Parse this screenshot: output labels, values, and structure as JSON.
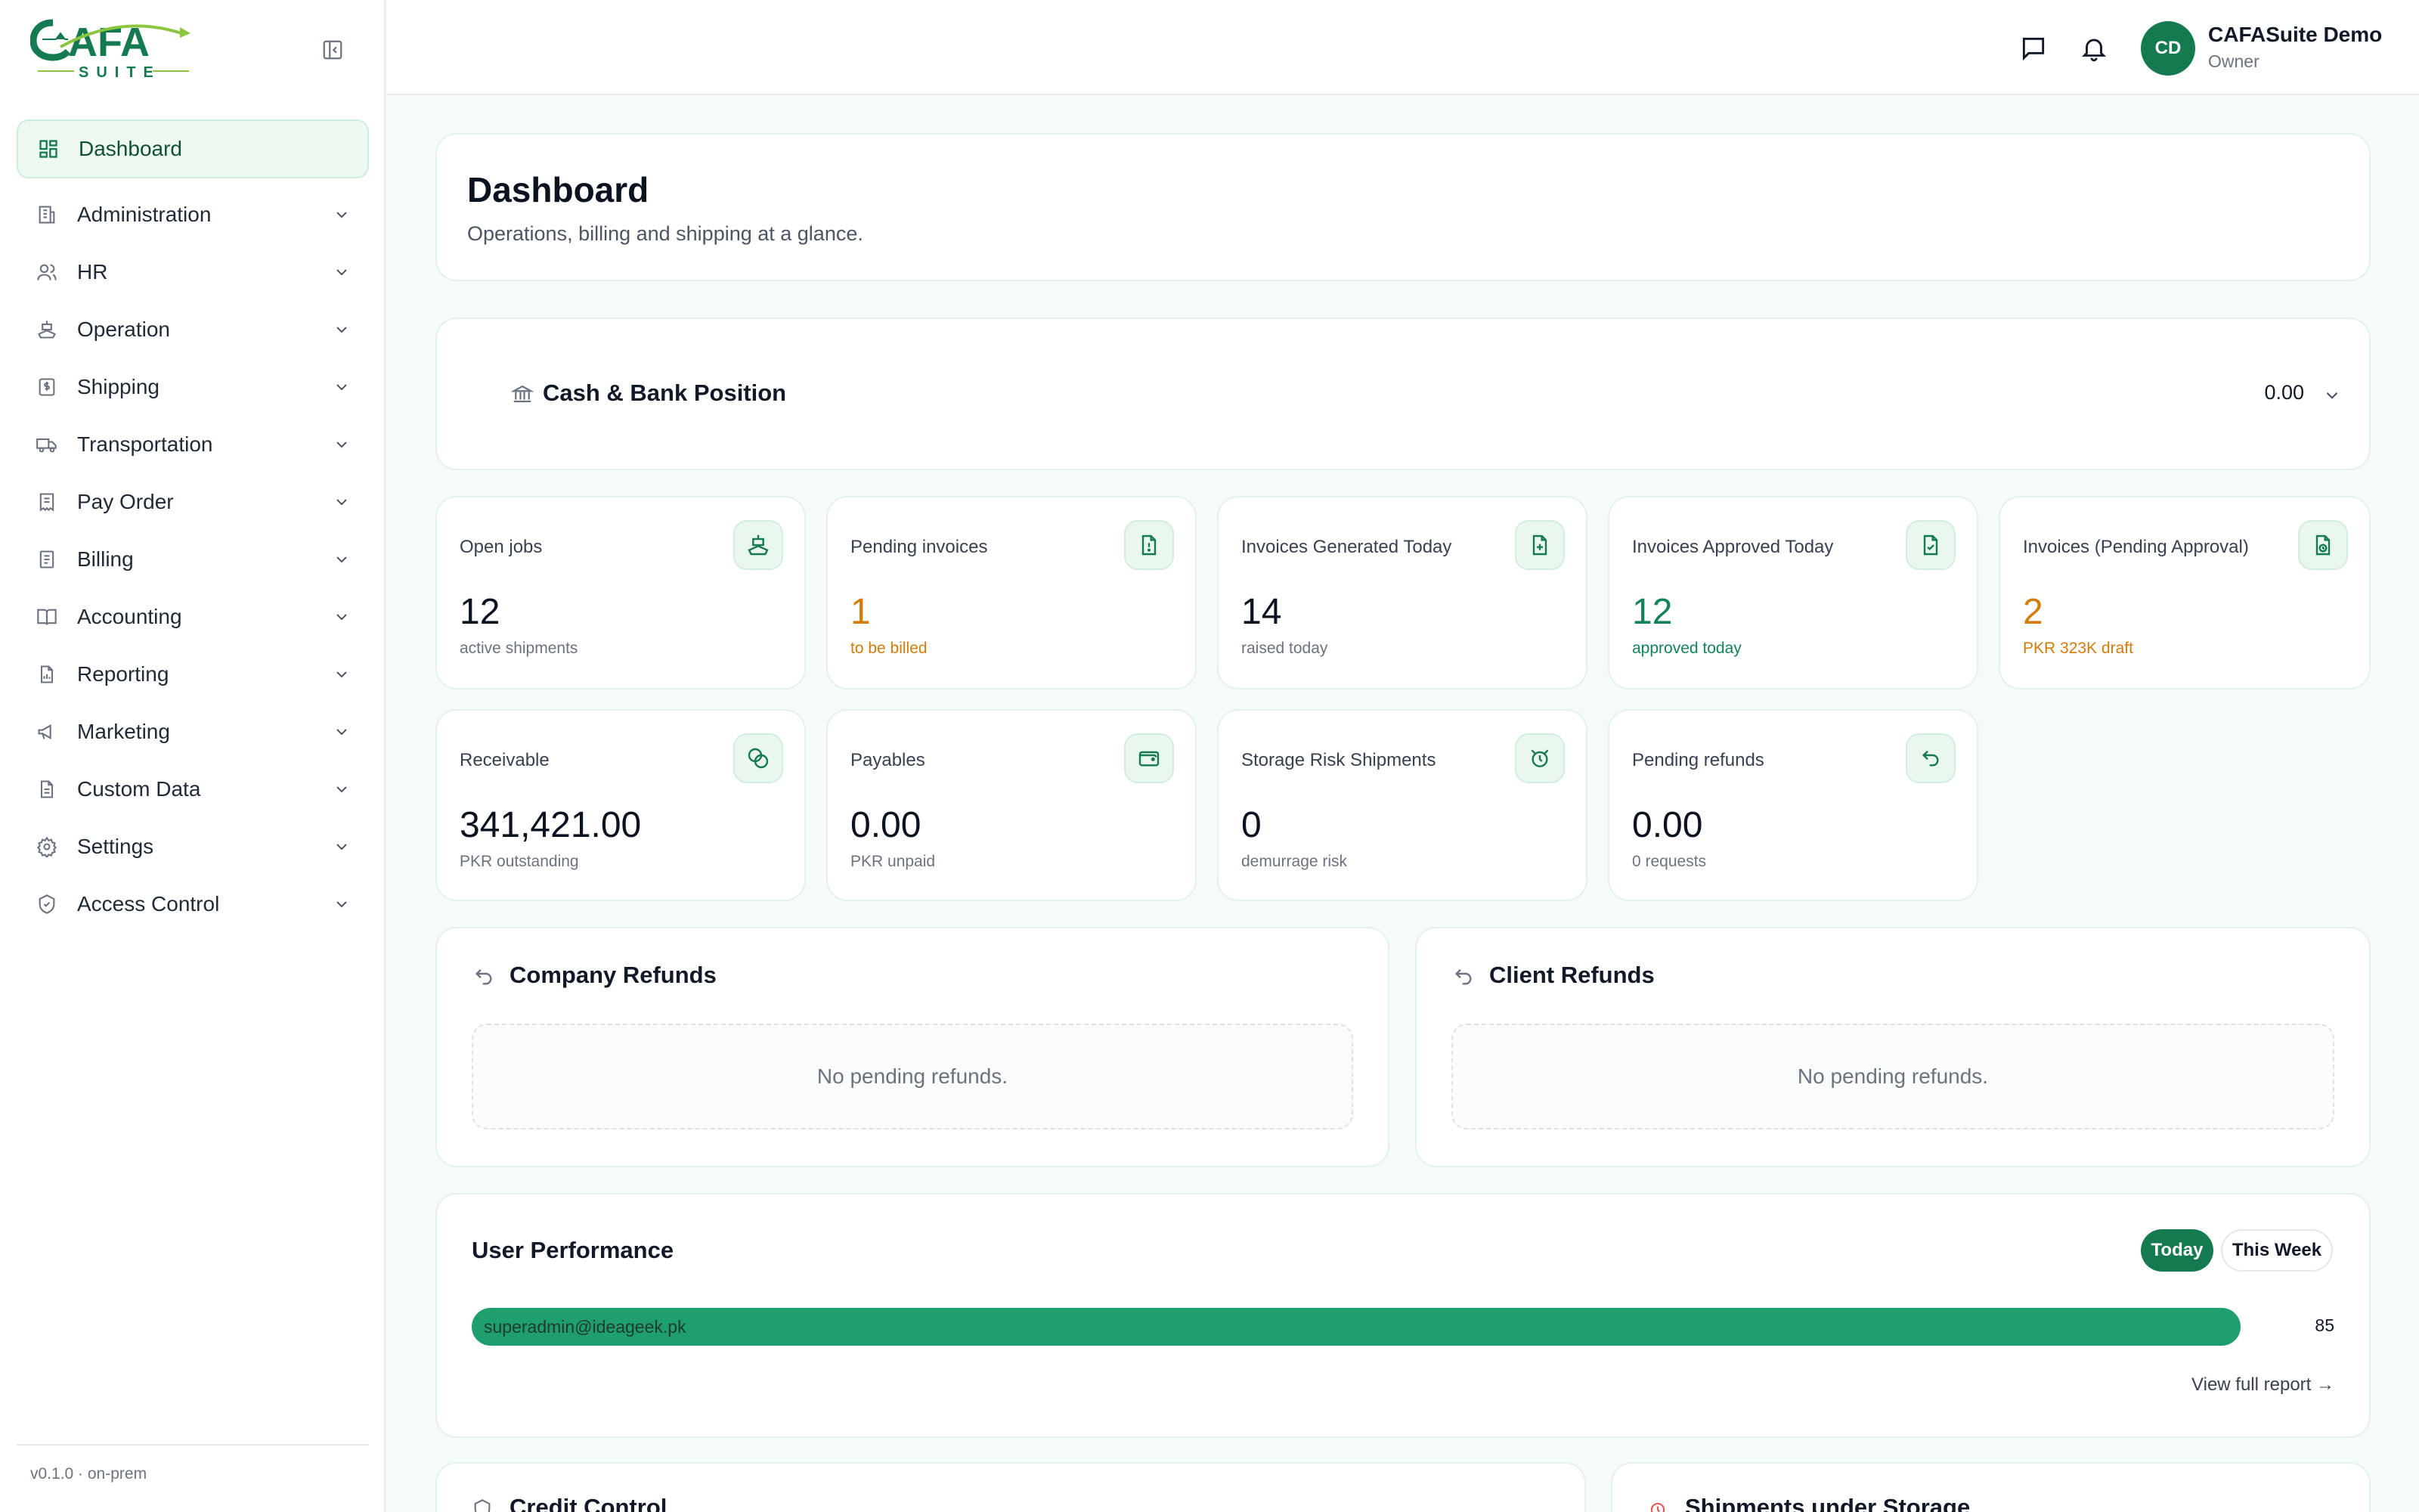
{
  "brand": {
    "logo_top": "CAFA",
    "logo_bottom": "SUITE",
    "version": "v0.1.0 · on-prem"
  },
  "sidebar": {
    "items": [
      {
        "label": "Dashboard",
        "icon": "grid-icon",
        "active": true
      },
      {
        "label": "Administration",
        "icon": "building-icon"
      },
      {
        "label": "HR",
        "icon": "users-icon"
      },
      {
        "label": "Operation",
        "icon": "ship-icon"
      },
      {
        "label": "Shipping",
        "icon": "dollar-doc-icon"
      },
      {
        "label": "Transportation",
        "icon": "truck-icon"
      },
      {
        "label": "Pay Order",
        "icon": "receipt-icon"
      },
      {
        "label": "Billing",
        "icon": "billing-icon"
      },
      {
        "label": "Accounting",
        "icon": "book-icon"
      },
      {
        "label": "Reporting",
        "icon": "report-icon"
      },
      {
        "label": "Marketing",
        "icon": "megaphone-icon"
      },
      {
        "label": "Custom Data",
        "icon": "file-icon"
      },
      {
        "label": "Settings",
        "icon": "gear-icon"
      },
      {
        "label": "Access Control",
        "icon": "shield-icon"
      }
    ]
  },
  "header": {
    "user_initials": "CD",
    "user_name": "CAFASuite Demo",
    "user_role": "Owner"
  },
  "page": {
    "title": "Dashboard",
    "subtitle": "Operations, billing and shipping at a glance."
  },
  "cash": {
    "title": "Cash & Bank Position",
    "value": "0.00"
  },
  "stats": [
    {
      "label": "Open jobs",
      "value": "12",
      "sub": "active shipments",
      "tone": "default",
      "icon": "ship-icon"
    },
    {
      "label": "Pending invoices",
      "value": "1",
      "sub": "to be billed",
      "tone": "orange",
      "icon": "file-alert-icon"
    },
    {
      "label": "Invoices Generated Today",
      "value": "14",
      "sub": "raised today",
      "tone": "default",
      "icon": "file-plus-icon"
    },
    {
      "label": "Invoices Approved Today",
      "value": "12",
      "sub": "approved today",
      "tone": "green",
      "icon": "file-check-icon"
    },
    {
      "label": "Invoices (Pending Approval)",
      "value": "2",
      "sub": "PKR 323K draft",
      "tone": "orange",
      "icon": "file-clock-icon"
    },
    {
      "label": "Receivable",
      "value": "341,421.00",
      "sub": "PKR outstanding",
      "tone": "default",
      "icon": "coins-icon"
    },
    {
      "label": "Payables",
      "value": "0.00",
      "sub": "PKR unpaid",
      "tone": "default",
      "icon": "wallet-icon"
    },
    {
      "label": "Storage Risk Shipments",
      "value": "0",
      "sub": "demurrage risk",
      "tone": "default",
      "icon": "alarm-icon"
    },
    {
      "label": "Pending refunds",
      "value": "0.00",
      "sub": "0 requests",
      "tone": "default",
      "icon": "undo-icon"
    }
  ],
  "refunds": {
    "company": {
      "title": "Company Refunds",
      "empty": "No pending refunds."
    },
    "client": {
      "title": "Client Refunds",
      "empty": "No pending refunds."
    }
  },
  "performance": {
    "title": "User Performance",
    "today_label": "Today",
    "week_label": "This Week",
    "users": [
      {
        "email": "superadmin@ideageek.pk",
        "score": "85",
        "fraction": 1.0
      }
    ],
    "view_link": "View full report →"
  },
  "bottom": {
    "credit_title": "Credit Control",
    "storage_title": "Shipments under Storage"
  },
  "colors": {
    "primary": "#157a4f",
    "accent": "#1f9e6e",
    "orange": "#d27c0a"
  }
}
